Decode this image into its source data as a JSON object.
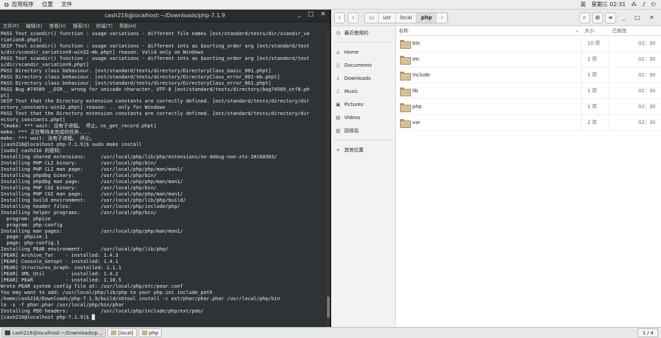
{
  "topbar": {
    "apps_label": "应用程序",
    "places_label": "位置",
    "files_label": "文件",
    "lang": "英",
    "clock": "星期三 02:31"
  },
  "terminal": {
    "title": "cash216@localhost:~/Downloads/php-7.1.9",
    "menu": [
      "文件(F)",
      "编辑(E)",
      "查看(V)",
      "搜索(S)",
      "终端(T)",
      "帮助(H)"
    ],
    "lines": [
      "PASS Test scandir() function : usage variations - different file names [ext/standard/tests/dir/scandir_va",
      "riation8.phpt]",
      "SKIP Test scandir() function : usage variations - different ints as $sorting_order arg [ext/standard/test",
      "s/dir/scandir_variation9-win32-mb.phpt] reason: Valid only on Windows",
      "PASS Test scandir() function : usage variations - different ints as $sorting_order arg [ext/standard/test",
      "s/dir/scandir_variation9.phpt]",
      "PASS Directory class behaviour. [ext/standard/tests/directory/DirectoryClass_basic_001.phpt]",
      "PASS Directory class behaviour. [ext/standard/tests/directory/DirectoryClass_error_001-mb.phpt]",
      "PASS Directory class behaviour. [ext/standard/tests/directory/DirectoryClass_error_001.phpt]",
      "PASS Bug #74589 __DIR__ wrong for unicode character, UTF-8 [ext/standard/tests/directory/bug74589_utf8.ph",
      "pt]",
      "SKIP Test that the Directory extension constants are correctly defined. [ext/standard/tests/directory/dir",
      "ectory_constants-win32.phpt] reason: .. only for Windows",
      "PASS Test that the Directory extension constants are correctly defined. [ext/standard/tests/directory/dir",
      "ectory_constants.phpt]",
      "^Cmake: *** wait: 没有子进程。 停止。ns_get_record.phpt]",
      "make: *** 正在等待未完成的任务....",
      "make: *** wait: 没有子进程。 停止。",
      "[cash216@localhost php-7.1.9]$ sudo make install",
      "[sudo] cash216 的密码：",
      "Installing shared extensions:     /usr/local/php/lib/php/extensions/no-debug-non-zts-20160303/",
      "Installing PHP CLI binary:        /usr/local/php/bin/",
      "Installing PHP CLI man page:      /usr/local/php/php/man/man1/",
      "Installing phpdbg binary:         /usr/local/php/bin/",
      "Installing phpdbg man page:       /usr/local/php/php/man/man1/",
      "Installing PHP CGI binary:        /usr/local/php/bin/",
      "Installing PHP CGI man page:      /usr/local/php/php/man/man1/",
      "Installing build environment:     /usr/local/php/lib/php/build/",
      "Installing header files:          /usr/local/php/include/php/",
      "Installing helper programs:       /usr/local/php/bin/",
      "  program: phpize",
      "  program: php-config",
      "Installing man pages:             /usr/local/php/php/man/man1/",
      "  page: phpize.1",
      "  page: php-config.1",
      "Installing PEAR environment:      /usr/local/php/lib/php/",
      "[PEAR] Archive_Tar    - installed: 1.4.3",
      "[PEAR] Console_Getopt - installed: 1.4.1",
      "[PEAR] Structures_Graph- installed: 1.1.1",
      "[PEAR] XML_Util       - installed: 1.4.2",
      "[PEAR] PEAR           - installed: 1.10.5",
      "Wrote PEAR system config file at: /usr/local/php/etc/pear.conf",
      "You may want to add: /usr/local/php/lib/php to your php.ini include_path",
      "/home/cash216/Downloads/php-7.1.9/build/shtool install -c ext/phar/phar.phar /usr/local/php/bin",
      "ln -s -f phar.phar /usr/local/php/bin/phar",
      "Installing PDO headers:           /usr/local/php/include/php/ext/pdo/",
      "[cash216@localhost php-7.1.9]$ █"
    ]
  },
  "filemanager": {
    "crumbs": [
      "usr",
      "local",
      "php"
    ],
    "sidebar": [
      {
        "icon": "clock-icon",
        "glyph": "◷",
        "label": "最近使用的"
      },
      {
        "icon": "home-icon",
        "glyph": "⌂",
        "label": "Home"
      },
      {
        "icon": "document-icon",
        "glyph": "▯",
        "label": "Documents"
      },
      {
        "icon": "download-icon",
        "glyph": "↓",
        "label": "Downloads"
      },
      {
        "icon": "music-icon",
        "glyph": "♪",
        "label": "Music"
      },
      {
        "icon": "picture-icon",
        "glyph": "▣",
        "label": "Pictures"
      },
      {
        "icon": "video-icon",
        "glyph": "▤",
        "label": "Videos"
      },
      {
        "icon": "trash-icon",
        "glyph": "▥",
        "label": "回收站"
      },
      {
        "icon": "plus-icon",
        "glyph": "+",
        "label": "其他位置"
      }
    ],
    "columns": {
      "name": "名称",
      "size": "大小",
      "modified": "已修改"
    },
    "files": [
      {
        "name": "bin",
        "size": "10 项",
        "modified": "02：30"
      },
      {
        "name": "etc",
        "size": "1 项",
        "modified": "02：30"
      },
      {
        "name": "include",
        "size": "1 项",
        "modified": "02：30"
      },
      {
        "name": "lib",
        "size": "1 项",
        "modified": "02：30"
      },
      {
        "name": "php",
        "size": "1 项",
        "modified": "02：30"
      },
      {
        "name": "var",
        "size": "2 项",
        "modified": "02：30"
      }
    ]
  },
  "taskbar": {
    "tasks": [
      {
        "label": "cash216@localhost:~/Downloads/p…",
        "kind": "terminal"
      },
      {
        "label": "[local]",
        "kind": "folder"
      },
      {
        "label": "php",
        "kind": "folder"
      }
    ],
    "pages": "1 / 4"
  }
}
